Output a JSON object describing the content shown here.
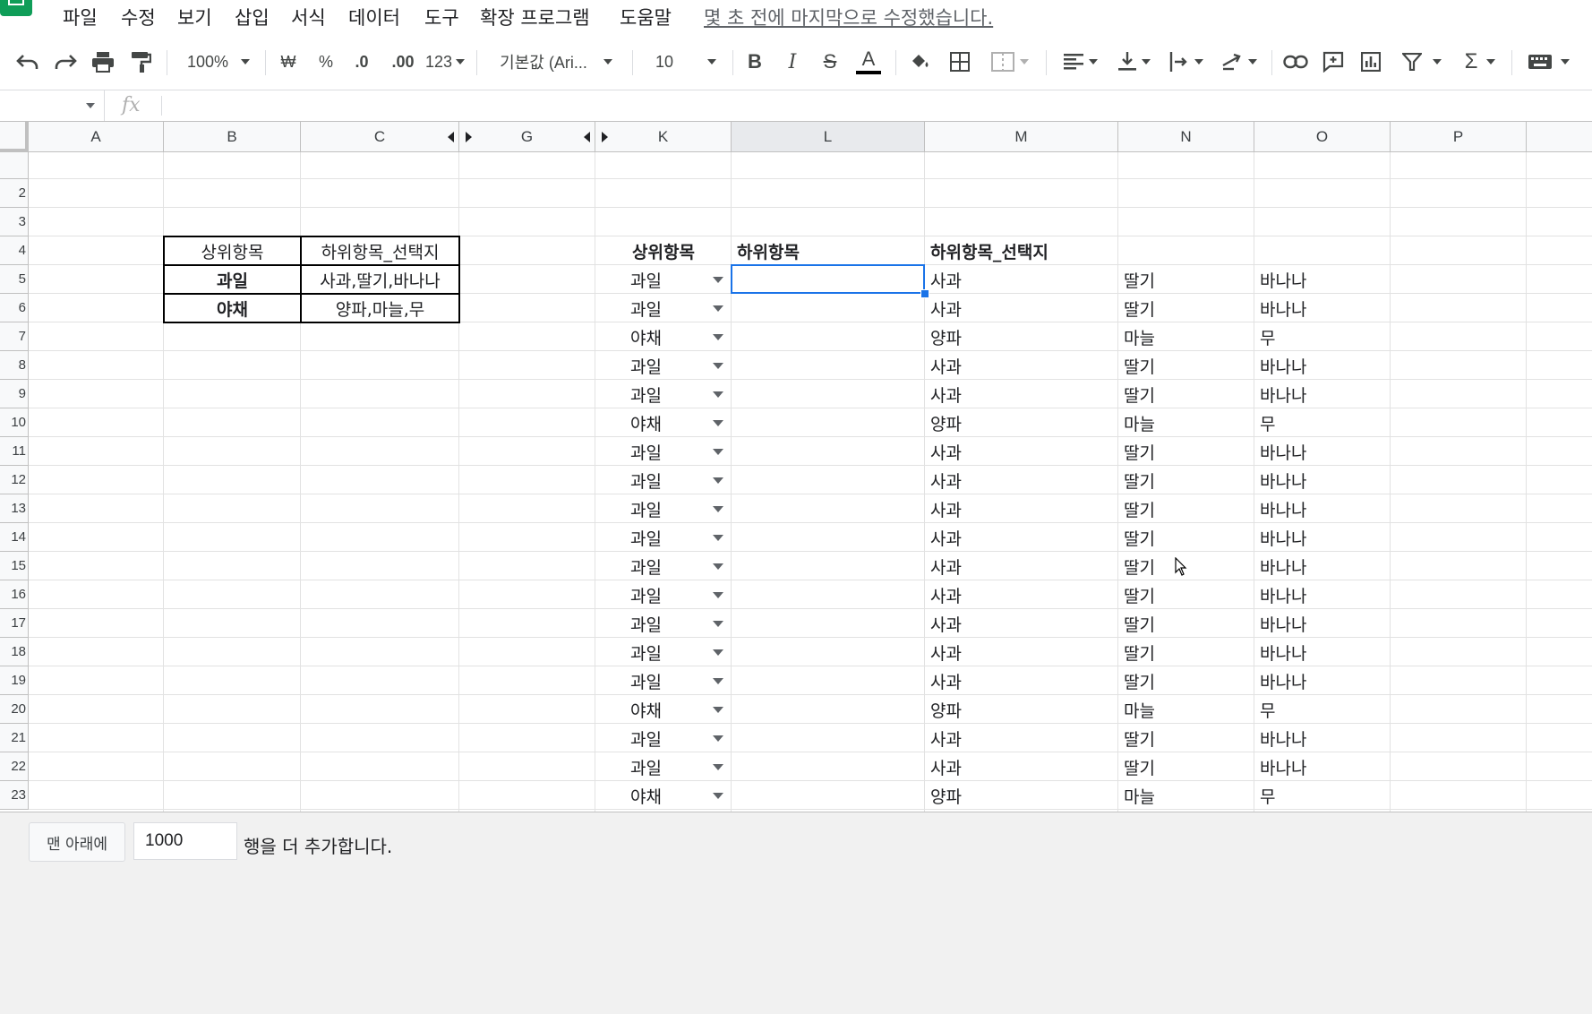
{
  "menu": {
    "items": [
      "파일",
      "수정",
      "보기",
      "삽입",
      "서식",
      "데이터",
      "도구",
      "확장 프로그램",
      "도움말"
    ],
    "last_edit": "몇 초 전에 마지막으로 수정했습니다."
  },
  "toolbar": {
    "zoom": "100%",
    "currency": "₩",
    "percent": "%",
    "decrease_decimal": ".0",
    "increase_decimal": ".00",
    "more_formats": "123",
    "font": "기본값 (Ari...",
    "font_size": "10",
    "bold": "B",
    "italic": "I",
    "strikethrough": "S",
    "text_color": "A",
    "sum": "Σ"
  },
  "formula_bar": {
    "fx": "fx",
    "cell_ref": "",
    "content": ""
  },
  "columns": [
    "A",
    "B",
    "C",
    "G",
    "K",
    "L",
    "M",
    "N",
    "O",
    "P"
  ],
  "rows": [
    "",
    "2",
    "3",
    "4",
    "5",
    "6",
    "7",
    "8",
    "9",
    "10",
    "11",
    "12",
    "13",
    "14",
    "15",
    "16",
    "17",
    "18",
    "19",
    "20",
    "21",
    "22",
    "23"
  ],
  "lookup_table": {
    "header": [
      "상위항목",
      "하위항목_선택지"
    ],
    "rows": [
      [
        "과일",
        "사과,딸기,바나나"
      ],
      [
        "야채",
        "양파,마늘,무"
      ]
    ]
  },
  "main_table": {
    "header": [
      "상위항목",
      "하위항목",
      "하위항목_선택지"
    ],
    "rows": [
      [
        "과일",
        "",
        "사과",
        "딸기",
        "바나나"
      ],
      [
        "과일",
        "",
        "사과",
        "딸기",
        "바나나"
      ],
      [
        "야채",
        "",
        "양파",
        "마늘",
        "무"
      ],
      [
        "과일",
        "",
        "사과",
        "딸기",
        "바나나"
      ],
      [
        "과일",
        "",
        "사과",
        "딸기",
        "바나나"
      ],
      [
        "야채",
        "",
        "양파",
        "마늘",
        "무"
      ],
      [
        "과일",
        "",
        "사과",
        "딸기",
        "바나나"
      ],
      [
        "과일",
        "",
        "사과",
        "딸기",
        "바나나"
      ],
      [
        "과일",
        "",
        "사과",
        "딸기",
        "바나나"
      ],
      [
        "과일",
        "",
        "사과",
        "딸기",
        "바나나"
      ],
      [
        "과일",
        "",
        "사과",
        "딸기",
        "바나나"
      ],
      [
        "과일",
        "",
        "사과",
        "딸기",
        "바나나"
      ],
      [
        "과일",
        "",
        "사과",
        "딸기",
        "바나나"
      ],
      [
        "과일",
        "",
        "사과",
        "딸기",
        "바나나"
      ],
      [
        "과일",
        "",
        "사과",
        "딸기",
        "바나나"
      ],
      [
        "야채",
        "",
        "양파",
        "마늘",
        "무"
      ],
      [
        "과일",
        "",
        "사과",
        "딸기",
        "바나나"
      ],
      [
        "과일",
        "",
        "사과",
        "딸기",
        "바나나"
      ],
      [
        "야채",
        "",
        "양파",
        "마늘",
        "무"
      ]
    ]
  },
  "footer": {
    "add_button": "맨 아래에",
    "rows_value": "1000",
    "rows_suffix": "행을 더 추가합니다."
  },
  "colors": {
    "selection": "#1a73e8",
    "header_bg": "#f8f9fa",
    "gridline": "#e2e2e2",
    "brand": "#0f9d58"
  }
}
